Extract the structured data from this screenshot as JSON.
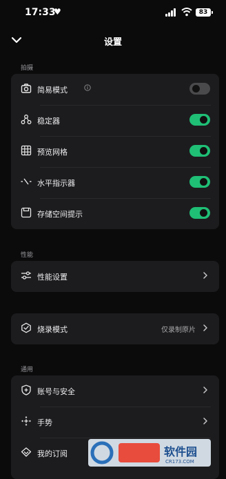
{
  "status_bar": {
    "time": "17:33",
    "battery": "83"
  },
  "header": {
    "title": "设置"
  },
  "sections": {
    "shooting": {
      "label": "拍摄",
      "items": [
        {
          "label": "简易模式",
          "icon": "camera-icon",
          "toggle": "off"
        },
        {
          "label": "稳定器",
          "icon": "stabilizer-icon",
          "toggle": "on"
        },
        {
          "label": "预览网格",
          "icon": "grid-icon",
          "toggle": "on"
        },
        {
          "label": "水平指示器",
          "icon": "level-indicator-icon",
          "toggle": "on"
        },
        {
          "label": "存储空间提示",
          "icon": "storage-icon",
          "toggle": "on"
        }
      ]
    },
    "performance": {
      "label": "性能",
      "items": [
        {
          "label": "性能设置",
          "icon": "sliders-icon"
        }
      ]
    },
    "burn": {
      "items": [
        {
          "label": "烧录模式",
          "icon": "burn-mode-icon",
          "value": "仅录制原片"
        }
      ]
    },
    "general": {
      "label": "通用",
      "items": [
        {
          "label": "账号与安全",
          "icon": "shield-icon"
        },
        {
          "label": "手势",
          "icon": "gesture-icon"
        },
        {
          "label": "我的订阅",
          "icon": "subscription-icon"
        }
      ]
    }
  },
  "watermark": {
    "text": "软件园",
    "sub": "CR173.COM"
  },
  "colors": {
    "accent": "#1fbf76",
    "card": "#1c1c1e",
    "background": "#0b0b0c"
  }
}
